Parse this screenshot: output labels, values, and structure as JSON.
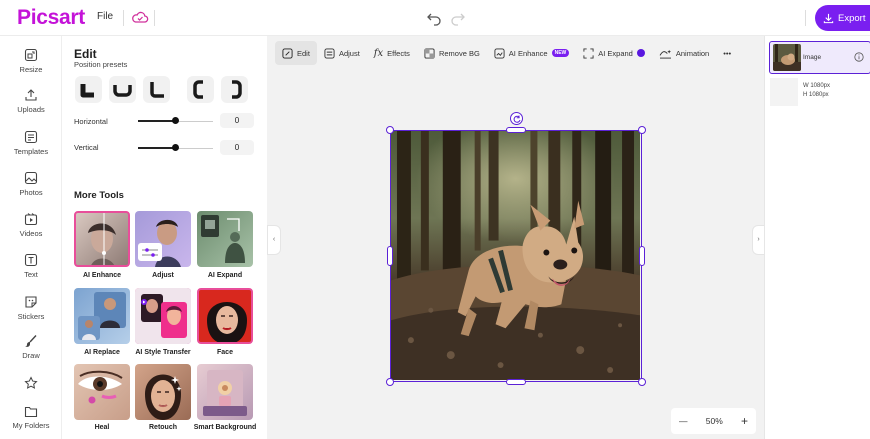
{
  "app": {
    "logo": "Picsart",
    "file_menu": "File",
    "export_label": "Export"
  },
  "nav": [
    {
      "label": "Resize",
      "icon": "resize-icon"
    },
    {
      "label": "Uploads",
      "icon": "upload-icon"
    },
    {
      "label": "Templates",
      "icon": "templates-icon"
    },
    {
      "label": "Photos",
      "icon": "photos-icon"
    },
    {
      "label": "Videos",
      "icon": "videos-icon"
    },
    {
      "label": "Text",
      "icon": "text-icon"
    },
    {
      "label": "Stickers",
      "icon": "stickers-icon"
    },
    {
      "label": "Draw",
      "icon": "draw-icon"
    },
    {
      "label": "",
      "icon": "star-icon"
    },
    {
      "label": "My Folders",
      "icon": "folder-icon"
    }
  ],
  "panel": {
    "title": "Edit",
    "subtitle": "Position presets",
    "horizontal_label": "Horizontal",
    "horizontal_value": "0",
    "vertical_label": "Vertical",
    "vertical_value": "0",
    "slider_h_level": 0.5,
    "slider_v_level": 0.5,
    "more_tools_title": "More Tools",
    "tools": [
      "AI Enhance",
      "Adjust",
      "AI Expand",
      "AI Replace",
      "AI Style Transfer",
      "Face",
      "Heal",
      "Retouch",
      "Smart Background"
    ]
  },
  "toolbar": {
    "edit": "Edit",
    "adjust": "Adjust",
    "effects": "Effects",
    "remove_bg": "Remove BG",
    "ai_enhance": "AI Enhance",
    "new_badge": "NEW",
    "ai_expand": "AI Expand",
    "animation": "Animation",
    "more": "•••"
  },
  "zoom": {
    "minus": "—",
    "value": "50%",
    "plus": "+"
  },
  "layers": {
    "name": "Image",
    "width": "W 1080px",
    "height": "H 1080px"
  },
  "colors": {
    "brand": "#c413d8",
    "accent": "#7a1ff0",
    "selection": "#5b21d6"
  }
}
